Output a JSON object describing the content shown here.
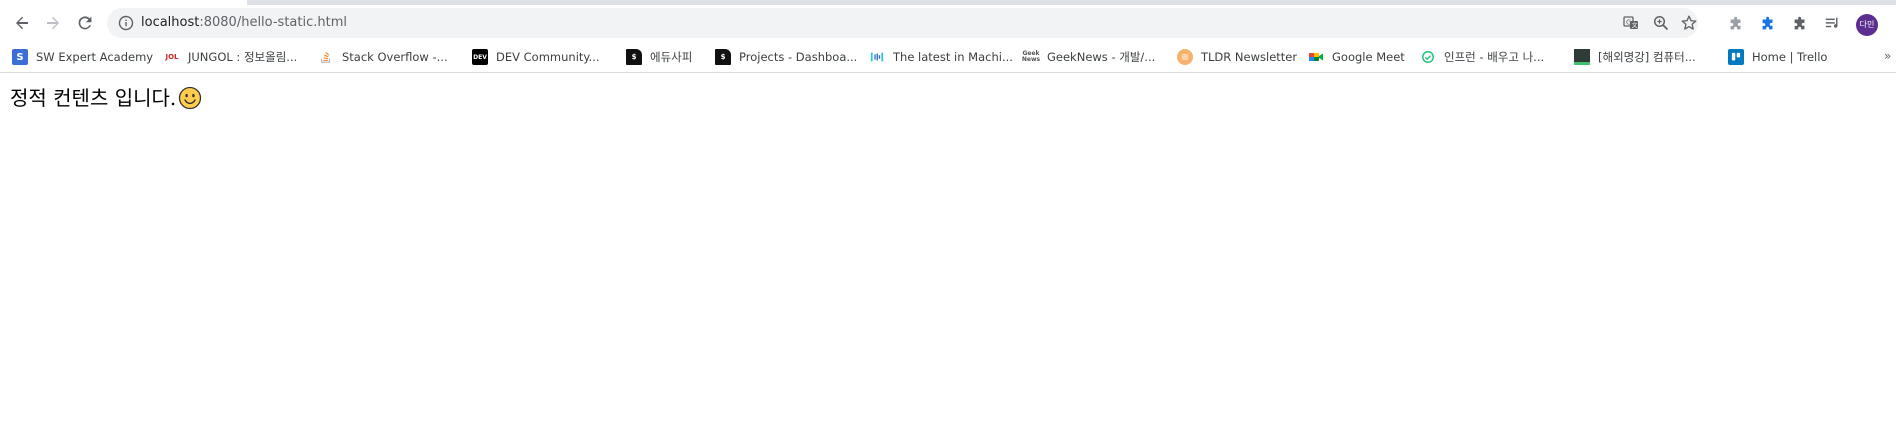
{
  "browser": {
    "address": {
      "host": "localhost",
      "path": ":8080/hello-static.html"
    },
    "avatar_text": "다민",
    "accent_color": "#1a73e8",
    "avatar_color": "#5b2e8f"
  },
  "bookmarks": [
    {
      "label": "SW Expert Academy",
      "icon": "swea-icon"
    },
    {
      "label": "JUNGOL : 정보올림...",
      "icon": "jungol-icon"
    },
    {
      "label": "Stack Overflow -...",
      "icon": "stackoverflow-icon"
    },
    {
      "label": "DEV Community...",
      "icon": "dev-icon"
    },
    {
      "label": "에듀사피",
      "icon": "bookmark-doc-icon"
    },
    {
      "label": "Projects - Dashboa...",
      "icon": "bookmark-doc-icon"
    },
    {
      "label": "The latest in Machi...",
      "icon": "paperswithcode-icon"
    },
    {
      "label": "GeekNews - 개발/...",
      "icon": "geeknews-icon"
    },
    {
      "label": "TLDR Newsletter",
      "icon": "tldr-icon"
    },
    {
      "label": "Google Meet",
      "icon": "google-meet-icon"
    },
    {
      "label": "인프런 - 배우고 나...",
      "icon": "inflearn-icon"
    },
    {
      "label": "[해외명강] 컴퓨터...",
      "icon": "kmooc-icon"
    },
    {
      "label": "Home | Trello",
      "icon": "trello-icon"
    }
  ],
  "bookmarks_more": "»",
  "page": {
    "text": "정적 컨텐츠 입니다."
  }
}
